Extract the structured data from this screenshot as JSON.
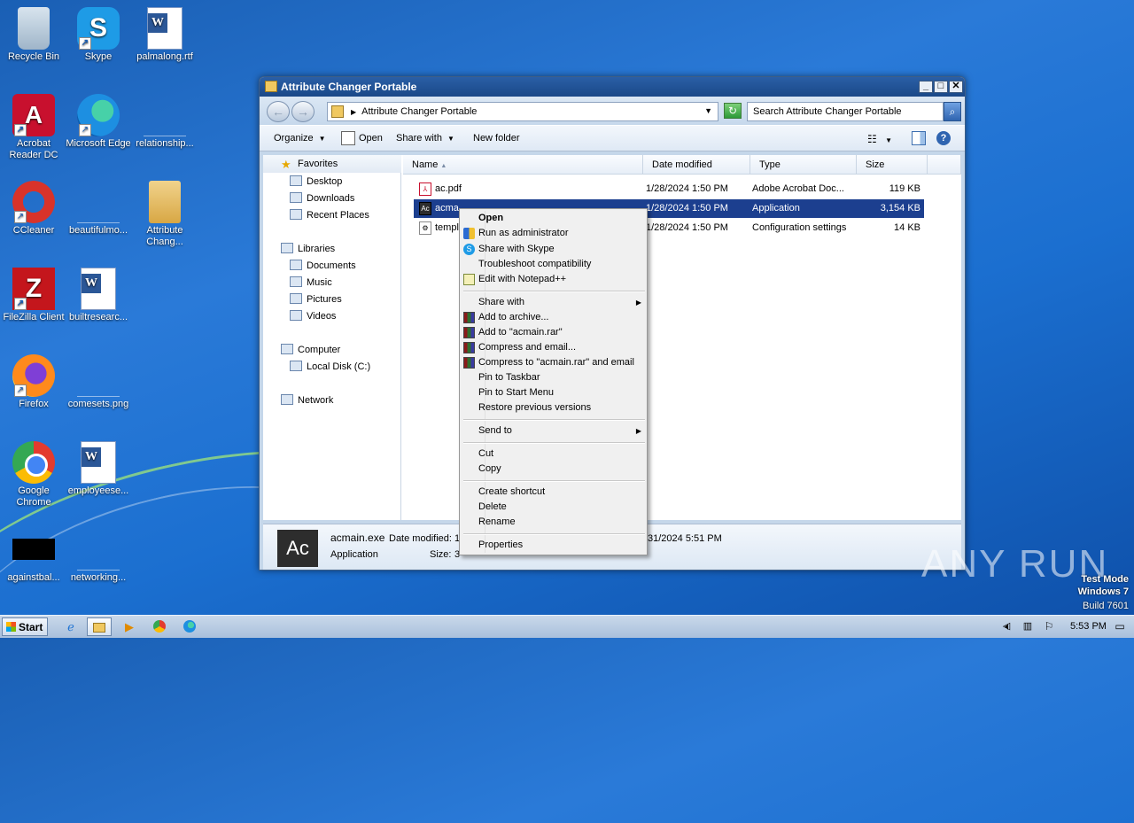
{
  "desktop": {
    "icons": [
      {
        "label": "Recycle Bin"
      },
      {
        "label": "Skype"
      },
      {
        "label": "palmalong.rtf"
      },
      {
        "label": "Acrobat Reader DC"
      },
      {
        "label": "Microsoft Edge"
      },
      {
        "label": "relationship..."
      },
      {
        "label": "CCleaner"
      },
      {
        "label": "beautifulmo..."
      },
      {
        "label": "Attribute Chang..."
      },
      {
        "label": "FileZilla Client"
      },
      {
        "label": "builtresearc..."
      },
      {
        "label": "Firefox"
      },
      {
        "label": "comesets.png"
      },
      {
        "label": "Google Chrome"
      },
      {
        "label": "employeese..."
      },
      {
        "label": "againstbal..."
      },
      {
        "label": "networking..."
      }
    ]
  },
  "window": {
    "title": "Attribute Changer Portable",
    "address": "Attribute Changer Portable",
    "search_placeholder": "Search Attribute Changer Portable",
    "toolbar": {
      "organize": "Organize",
      "open": "Open",
      "share_with": "Share with",
      "new_folder": "New folder"
    },
    "nav": {
      "favorites": "Favorites",
      "desktop": "Desktop",
      "downloads": "Downloads",
      "recent": "Recent Places",
      "libraries": "Libraries",
      "documents": "Documents",
      "music": "Music",
      "pictures": "Pictures",
      "videos": "Videos",
      "computer": "Computer",
      "local_disk": "Local Disk (C:)",
      "network": "Network"
    },
    "columns": {
      "name": "Name",
      "date": "Date modified",
      "type": "Type",
      "size": "Size"
    },
    "files": [
      {
        "name": "ac.pdf",
        "date": "1/28/2024 1:50 PM",
        "type": "Adobe Acrobat Doc...",
        "size": "119 KB"
      },
      {
        "name": "acmain.exe",
        "name_shown": "acma",
        "date": "1/28/2024 1:50 PM",
        "type": "Application",
        "size": "3,154 KB"
      },
      {
        "name": "template",
        "name_shown": "templ",
        "date": "1/28/2024 1:50 PM",
        "type": "Configuration settings",
        "size": "14 KB"
      }
    ],
    "details": {
      "icon_text": "Ac",
      "filename": "acmain.exe",
      "modified_label": "Date modified:",
      "modified_value": "1",
      "created_value": "31/2024 5:51 PM",
      "type": "Application",
      "size_label": "Size:",
      "size_value": "3"
    }
  },
  "context_menu": {
    "open": "Open",
    "run_as_admin": "Run as administrator",
    "share_skype": "Share with Skype",
    "troubleshoot": "Troubleshoot compatibility",
    "edit_notepad": "Edit with Notepad++",
    "share_with": "Share with",
    "add_archive": "Add to archive...",
    "add_rar": "Add to \"acmain.rar\"",
    "compress_email": "Compress and email...",
    "compress_rar_email": "Compress to \"acmain.rar\" and email",
    "pin_taskbar": "Pin to Taskbar",
    "pin_start": "Pin to Start Menu",
    "restore": "Restore previous versions",
    "send_to": "Send to",
    "cut": "Cut",
    "copy": "Copy",
    "create_shortcut": "Create shortcut",
    "delete": "Delete",
    "rename": "Rename",
    "properties": "Properties"
  },
  "taskbar": {
    "start": "Start",
    "clock": "5:53 PM"
  },
  "watermark": {
    "line1": "Test Mode",
    "line2": "Windows 7",
    "line3": "Build 7601",
    "brand": "ANY RUN"
  }
}
